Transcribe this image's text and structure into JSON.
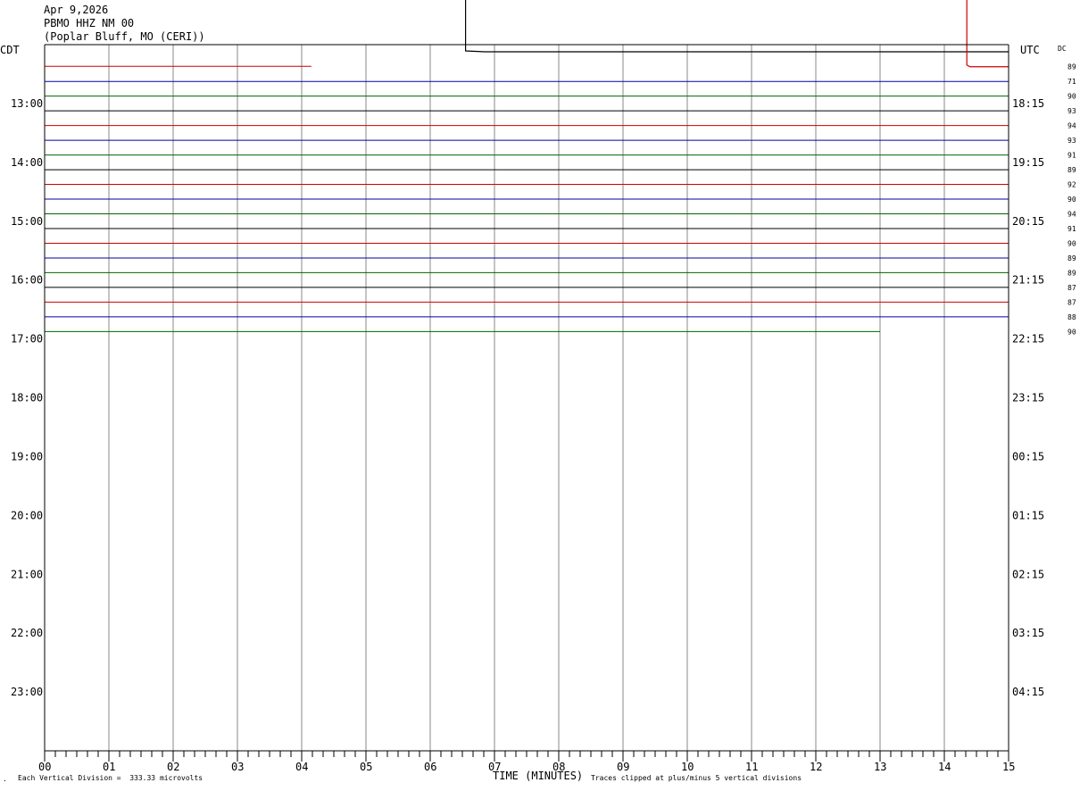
{
  "header": {
    "date": "Apr 9,2026",
    "station": "PBMO HHZ NM 00",
    "location": "(Poplar Bluff, MO (CERI))"
  },
  "chart_data": {
    "type": "line",
    "title": "",
    "xlabel": "TIME (MINUTES)",
    "left_axis_label": "CDT",
    "right_axis_label": "UTC",
    "dc_label": "DC",
    "x_ticks": [
      "00",
      "01",
      "02",
      "03",
      "04",
      "05",
      "06",
      "07",
      "08",
      "09",
      "10",
      "11",
      "12",
      "13",
      "14",
      "15"
    ],
    "xlim": [
      0,
      15
    ],
    "rows_total": 48,
    "rows_per_hour": 4,
    "left_hour_labels": [
      "13:00",
      "14:00",
      "15:00",
      "16:00",
      "17:00",
      "18:00",
      "19:00",
      "20:00",
      "21:00",
      "22:00",
      "23:00"
    ],
    "right_hour_labels": [
      "18:15",
      "19:15",
      "20:15",
      "21:15",
      "22:15",
      "23:15",
      "00:15",
      "01:15",
      "02:15",
      "03:15",
      "04:15"
    ],
    "trace_colors": [
      "#000000",
      "#cc0000",
      "#0000aa",
      "#006600"
    ],
    "traces": [
      {
        "row": 0,
        "color": "#000000",
        "start_min": 0,
        "end_min": 15,
        "dc": ""
      },
      {
        "row": 1,
        "color": "#cc0000",
        "start_min": 0,
        "end_min": 15,
        "dc": "89"
      },
      {
        "row": 2,
        "color": "#0000aa",
        "start_min": 0,
        "end_min": 15,
        "dc": "71"
      },
      {
        "row": 3,
        "color": "#006600",
        "start_min": 0,
        "end_min": 15,
        "dc": "90"
      },
      {
        "row": 4,
        "color": "#000000",
        "start_min": 0,
        "end_min": 15,
        "dc": "93"
      },
      {
        "row": 5,
        "color": "#cc0000",
        "start_min": 0,
        "end_min": 15,
        "dc": "94"
      },
      {
        "row": 6,
        "color": "#0000aa",
        "start_min": 0,
        "end_min": 15,
        "dc": "93"
      },
      {
        "row": 7,
        "color": "#006600",
        "start_min": 0,
        "end_min": 15,
        "dc": "91"
      },
      {
        "row": 8,
        "color": "#000000",
        "start_min": 0,
        "end_min": 15,
        "dc": "89"
      },
      {
        "row": 9,
        "color": "#cc0000",
        "start_min": 0,
        "end_min": 15,
        "dc": "92"
      },
      {
        "row": 10,
        "color": "#0000aa",
        "start_min": 0,
        "end_min": 15,
        "dc": "90"
      },
      {
        "row": 11,
        "color": "#006600",
        "start_min": 0,
        "end_min": 15,
        "dc": "94"
      },
      {
        "row": 12,
        "color": "#000000",
        "start_min": 0,
        "end_min": 15,
        "dc": "91"
      },
      {
        "row": 13,
        "color": "#cc0000",
        "start_min": 0,
        "end_min": 15,
        "dc": "90"
      },
      {
        "row": 14,
        "color": "#0000aa",
        "start_min": 0,
        "end_min": 15,
        "dc": "89"
      },
      {
        "row": 15,
        "color": "#006600",
        "start_min": 0,
        "end_min": 15,
        "dc": "89"
      },
      {
        "row": 16,
        "color": "#000000",
        "start_min": 0,
        "end_min": 15,
        "dc": "87"
      },
      {
        "row": 17,
        "color": "#cc0000",
        "start_min": 0,
        "end_min": 15,
        "dc": "87"
      },
      {
        "row": 18,
        "color": "#0000aa",
        "start_min": 0,
        "end_min": 15,
        "dc": "88"
      },
      {
        "row": 19,
        "color": "#006600",
        "start_min": 0,
        "end_min": 13,
        "dc": "90"
      }
    ],
    "first_row_red_segment_end_min": 4.15,
    "events": [
      {
        "row": 0,
        "color": "#000000",
        "minute": 6.55,
        "note": "large upward clipped spike"
      },
      {
        "row": 1,
        "color": "#cc0000",
        "minute": 14.35,
        "note": "large upward clipped spike"
      }
    ],
    "legend_left": "Each Vertical Division =  333.33 microvolts",
    "legend_right": "Traces clipped at plus/minus 5 vertical divisions"
  }
}
